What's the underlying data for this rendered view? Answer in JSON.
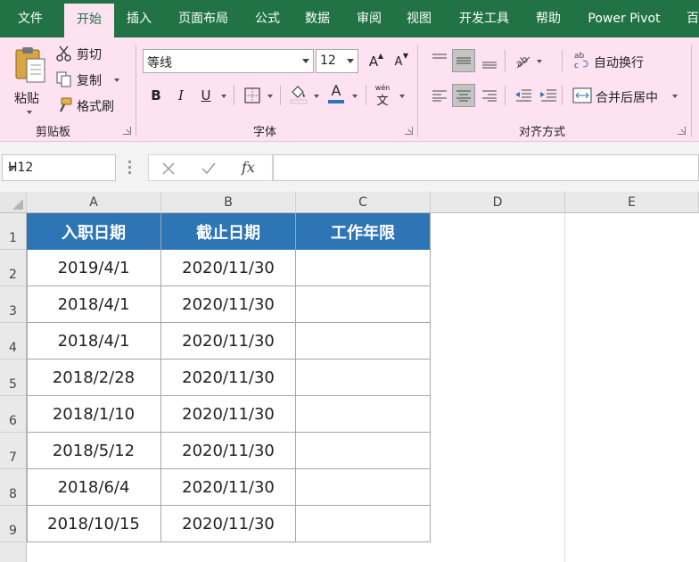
{
  "tabs": [
    {
      "label": "文件",
      "active": false
    },
    {
      "label": "开始",
      "active": true
    },
    {
      "label": "插入",
      "active": false
    },
    {
      "label": "页面布局",
      "active": false
    },
    {
      "label": "公式",
      "active": false
    },
    {
      "label": "数据",
      "active": false
    },
    {
      "label": "审阅",
      "active": false
    },
    {
      "label": "视图",
      "active": false
    },
    {
      "label": "开发工具",
      "active": false
    },
    {
      "label": "帮助",
      "active": false
    },
    {
      "label": "Power Pivot",
      "active": false
    },
    {
      "label": "百",
      "active": false
    }
  ],
  "ribbon": {
    "clipboard": {
      "paste_label": "粘贴",
      "cut_label": "剪切",
      "copy_label": "复制",
      "format_painter_label": "格式刷",
      "group_title": "剪贴板"
    },
    "font": {
      "font_name": "等线",
      "font_size": "12",
      "bold": "B",
      "italic": "I",
      "underline": "U",
      "font_color_glyph": "A",
      "phonetic_top": "wén",
      "phonetic_bottom": "文",
      "grow_glyph": "A",
      "shrink_glyph": "A",
      "group_title": "字体"
    },
    "alignment": {
      "wrap_text_label": "自动换行",
      "merge_center_label": "合并后居中",
      "group_title": "对齐方式"
    }
  },
  "formula_bar": {
    "name_box": "H12",
    "fx": "fx",
    "formula": ""
  },
  "sheet": {
    "columns": [
      "A",
      "B",
      "C",
      "D",
      "E"
    ],
    "rows": [
      "1",
      "2",
      "3",
      "4",
      "5",
      "6",
      "7",
      "8",
      "9"
    ],
    "header": [
      "入职日期",
      "截止日期",
      "工作年限"
    ],
    "data": [
      [
        "2019/4/1",
        "2020/11/30",
        ""
      ],
      [
        "2018/4/1",
        "2020/11/30",
        ""
      ],
      [
        "2018/4/1",
        "2020/11/30",
        ""
      ],
      [
        "2018/2/28",
        "2020/11/30",
        ""
      ],
      [
        "2018/1/10",
        "2020/11/30",
        ""
      ],
      [
        "2018/5/12",
        "2020/11/30",
        ""
      ],
      [
        "2018/6/4",
        "2020/11/30",
        ""
      ],
      [
        "2018/10/15",
        "2020/11/30",
        ""
      ]
    ]
  },
  "colors": {
    "title_bar": "#217346",
    "ribbon_bg": "#fde2f1",
    "table_header": "#2e75b6",
    "font_color_bar": "#2e75b6"
  }
}
